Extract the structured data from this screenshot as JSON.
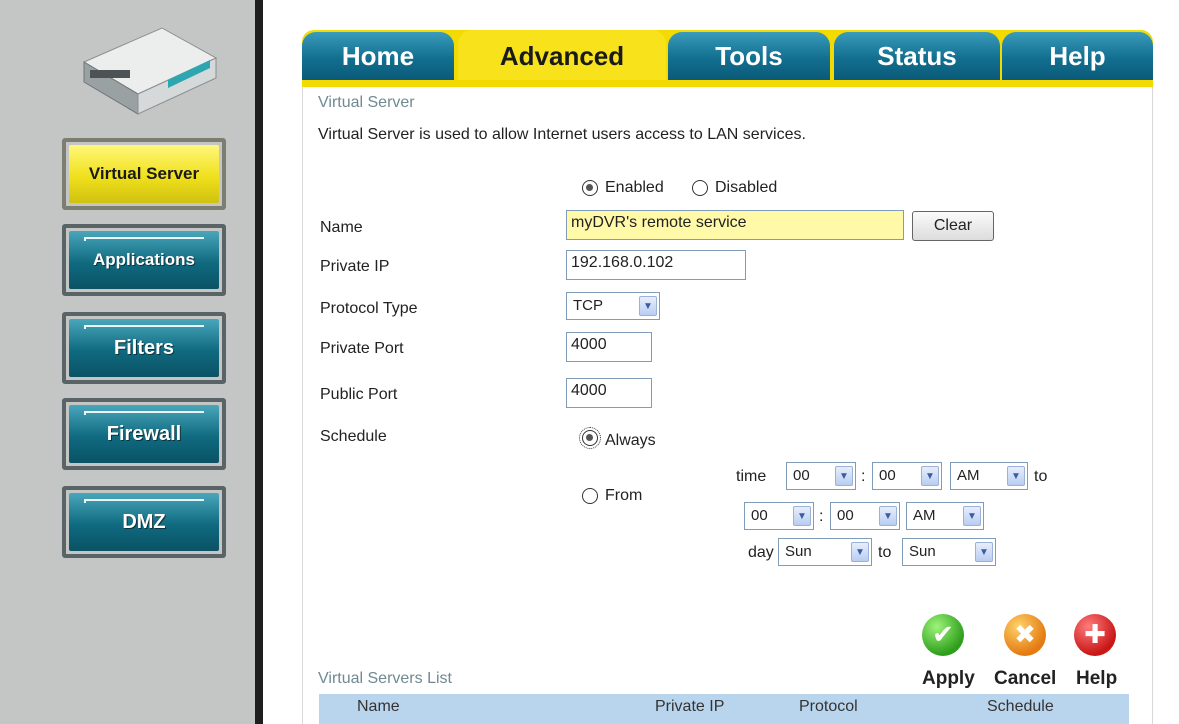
{
  "sidebar": {
    "items": [
      {
        "label": "Virtual Server",
        "active": true
      },
      {
        "label": "Applications",
        "active": false
      },
      {
        "label": "Filters",
        "active": false
      },
      {
        "label": "Firewall",
        "active": false
      },
      {
        "label": "DMZ",
        "active": false
      }
    ]
  },
  "tabs": [
    {
      "label": "Home",
      "active": false
    },
    {
      "label": "Advanced",
      "active": true
    },
    {
      "label": "Tools",
      "active": false
    },
    {
      "label": "Status",
      "active": false
    },
    {
      "label": "Help",
      "active": false
    }
  ],
  "page": {
    "section_title": "Virtual Server",
    "description": "Virtual Server is used to allow Internet users access to LAN services."
  },
  "form": {
    "enabled_label": "Enabled",
    "disabled_label": "Disabled",
    "status": "Enabled",
    "name_label": "Name",
    "name_value": "myDVR's remote service",
    "clear_label": "Clear",
    "private_ip_label": "Private IP",
    "private_ip_value": "192.168.0.102",
    "protocol_label": "Protocol Type",
    "protocol_value": "TCP",
    "private_port_label": "Private Port",
    "private_port_value": "4000",
    "public_port_label": "Public Port",
    "public_port_value": "4000",
    "schedule_label": "Schedule",
    "always_label": "Always",
    "from_label": "From",
    "schedule_mode": "Always",
    "time_label": "time",
    "to_label": "to",
    "day_label": "day",
    "colon": ":",
    "from_hour": "00",
    "from_min": "00",
    "from_ampm": "AM",
    "to_hour": "00",
    "to_min": "00",
    "to_ampm": "AM",
    "day_from": "Sun",
    "day_to": "Sun"
  },
  "actions": {
    "apply_label": "Apply",
    "cancel_label": "Cancel",
    "help_label": "Help"
  },
  "list": {
    "title": "Virtual Servers List",
    "columns": [
      "Name",
      "Private IP",
      "Protocol",
      "Schedule"
    ]
  },
  "colors": {
    "tab_active": "#f7e21c",
    "tab_inactive": "#126f90",
    "nav_active": "#f0e01c",
    "nav_inactive": "#0f6a80",
    "section_title": "#6f8a92",
    "list_header": "#b9d5ee"
  }
}
